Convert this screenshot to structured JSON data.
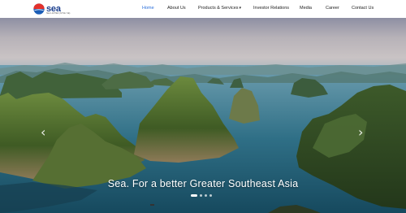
{
  "brand": {
    "name": "sea",
    "subtitle": "SEA LIMITED (NYSE: SE)",
    "logo_colors": {
      "red": "#e4312b",
      "blue": "#1b5db7",
      "navy": "#1b3f8f"
    }
  },
  "nav": {
    "items": [
      {
        "label": "Home",
        "active": true
      },
      {
        "label": "About Us"
      },
      {
        "label": "Products & Services",
        "caret": "▾"
      },
      {
        "label": "Investor Relations"
      },
      {
        "label": "Media"
      },
      {
        "label": "Career"
      },
      {
        "label": "Contact Us"
      }
    ],
    "active_color": "#2a6fdb"
  },
  "hero": {
    "tagline": "Sea. For a better Greater Southeast Asia",
    "prev_icon": "‹",
    "next_icon": "›",
    "slide_count": 4,
    "active_slide": 1
  }
}
